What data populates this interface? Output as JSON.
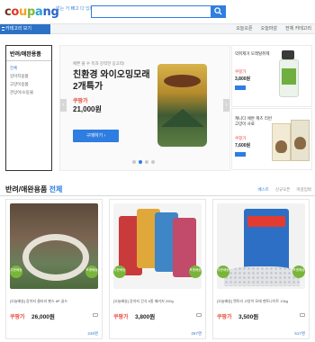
{
  "header": {
    "logo": {
      "c": "c",
      "o": "o",
      "u": "u",
      "p": "p",
      "a": "a",
      "ng": "ng"
    },
    "tagline": "없는 거 빼고 다 있다",
    "search_placeholder": ""
  },
  "nav": {
    "category_button": "카테고리 보기",
    "links": [
      "오늘오픈",
      "오늘마감",
      "전체 카테고리"
    ]
  },
  "sidebar": {
    "title": "반려/애완용품",
    "items": [
      "전체",
      "강아지용품",
      "고양이용품",
      "관상어/소동물"
    ]
  },
  "banner": {
    "subtitle": "예쁜 풀 수 목과 강력한 응고력!",
    "title": "친환경 와이오밍모래 2개특가",
    "brand": "쿠팡가",
    "price": "21,000원",
    "buy_button": "구매하기",
    "prev": "‹",
    "next": "›"
  },
  "side_ads": [
    {
      "title": "악취제거 모래탈취제",
      "brand": "쿠팡가",
      "price": "3,800원"
    },
    {
      "title": "캐니다 애완 캐츠 리번 고양이 사료",
      "brand": "쿠팡가",
      "price": "7,600원"
    }
  ],
  "section": {
    "title": "반려/애완용품",
    "all": "전체",
    "sort": [
      "베스트",
      "신규오픈",
      "마감임박"
    ]
  },
  "products": [
    {
      "name": "[오늘배송] 강아지 울타리 펜스 8P 골드",
      "brand": "쿠팡가",
      "price": "26,000원",
      "rating": "249명",
      "badges": [
        "주문배송",
        "포켓배송"
      ]
    },
    {
      "name": "[오늘배송] 강아지 간식 5종 패키지 200g",
      "brand": "쿠팡가",
      "price": "3,800원",
      "rating": "257명",
      "badges": [
        "주문배송",
        "포켓배송"
      ]
    },
    {
      "name": "[오늘배송] 캣토리 고양이 모래 벤토나이트 10kg",
      "brand": "쿠팡가",
      "price": "3,500원",
      "rating": "517명",
      "badges": [
        "주문배송",
        "포켓배송"
      ]
    }
  ],
  "bag_label": "WYOMING",
  "cat_bag_label": "CAT-TORY"
}
